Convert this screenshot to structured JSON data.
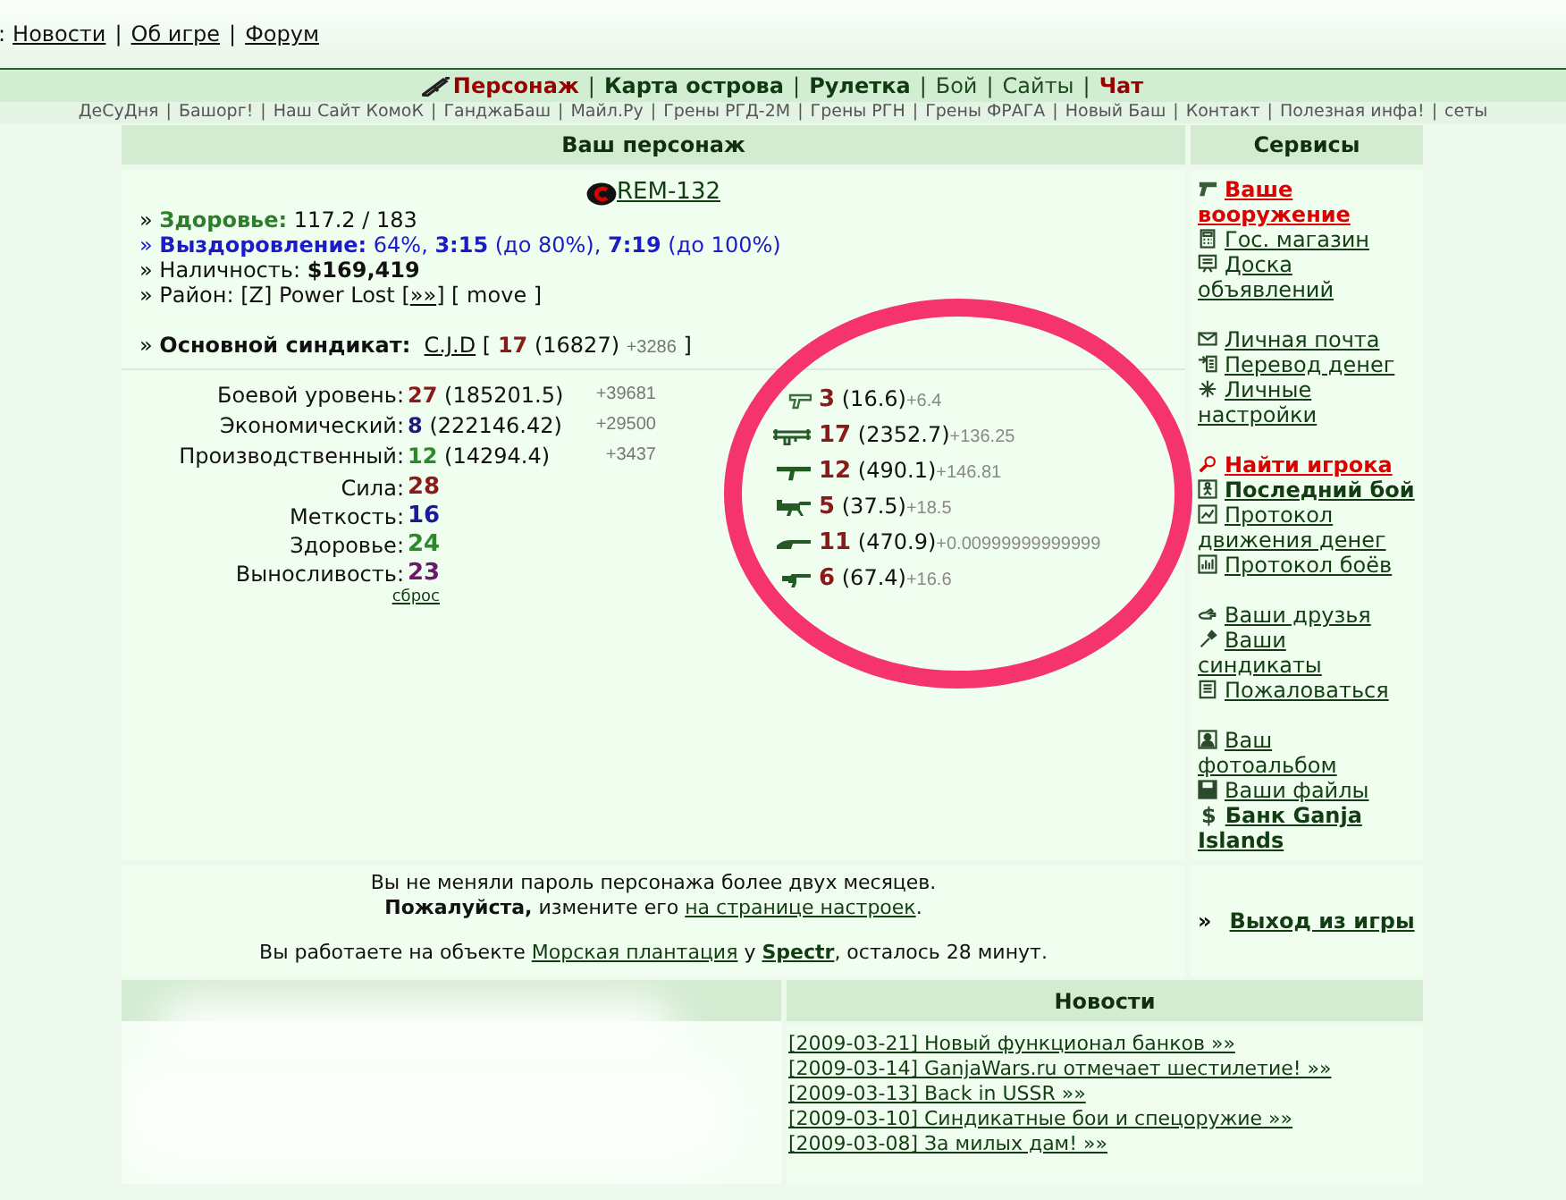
{
  "top_links": {
    "lead": ":",
    "separator": "|",
    "links": [
      "Новости",
      "Об игре",
      "Форум"
    ]
  },
  "nav": {
    "separator": "|",
    "items": [
      {
        "label": "Персонаж",
        "selected": true,
        "bold": true,
        "color": "#990000"
      },
      {
        "label": "Карта острова",
        "selected": false,
        "bold": true,
        "color": "#103a10"
      },
      {
        "label": "Рулетка",
        "selected": false,
        "bold": true,
        "color": "#103a10"
      },
      {
        "label": "Бой",
        "selected": false,
        "bold": false,
        "color": "#1f4a1f"
      },
      {
        "label": "Сайты",
        "selected": false,
        "bold": false,
        "color": "#1f4a1f"
      },
      {
        "label": "Чат",
        "selected": false,
        "bold": true,
        "color": "#990000"
      }
    ]
  },
  "sites": {
    "separator": "|",
    "links": [
      "ДеСуДня",
      "Башорг!",
      "Наш Сайт КомоК",
      "ГанджаБаш",
      "Майл.Ру",
      "Грены РГД-2М",
      "Грены РГН",
      "Грены ФРАГА",
      "Новый Баш",
      "Контакт",
      "Полезная инфа!",
      "сеты"
    ]
  },
  "character": {
    "title": "Ваш персонаж",
    "name": "REM-132",
    "health": {
      "bullet": "»",
      "label": "Здоровье:",
      "value": "117.2 / 183"
    },
    "recovery": {
      "bullet": "»",
      "text": "**Выздоровление:** 64%, **3:15** (до 80%), **7:19** (до 100%)"
    },
    "cash": {
      "bullet": "»",
      "label": "Наличность:",
      "value": "$169,419"
    },
    "district": {
      "bullet": "»",
      "text": "Район: [Z] Power Lost [",
      "link": "»»",
      "after": "] [ move ]"
    },
    "syndicate": {
      "bullet": "»",
      "label": "Основной синдикат:",
      "name": "C.J.D",
      "open": "[",
      "rank": "17",
      "points": "(16827)",
      "gain": "+3286",
      "close": "]"
    },
    "skills": [
      {
        "label": "Боевой уровень:",
        "rank": "27",
        "points": "(185201.5)",
        "gain": "+39681",
        "color": "#8b1a1a"
      },
      {
        "label": "Экономический:",
        "rank": "8",
        "points": "(222146.42)",
        "gain": "+29500",
        "color": "#1a1a80"
      },
      {
        "label": "Производственный:",
        "rank": "12",
        "points": "(14294.4)",
        "gain": "+3437",
        "color": "#2a8a2a"
      }
    ],
    "attributes": [
      {
        "label": "Сила:",
        "value": "28",
        "color": "#8b1a1a"
      },
      {
        "label": "Меткость:",
        "value": "16",
        "color": "#1a1a9a"
      },
      {
        "label": "Здоровье:",
        "value": "24",
        "color": "#2a8a2a"
      },
      {
        "label": "Выносливость:",
        "value": "23",
        "color": "#6b1a6b"
      }
    ],
    "reset": "сброс",
    "weapons": [
      {
        "rank": "3",
        "points": "(16.6)",
        "gain": "+6.4"
      },
      {
        "rank": "17",
        "points": "(2352.7)",
        "gain": "+136.25"
      },
      {
        "rank": "12",
        "points": "(490.1)",
        "gain": "+146.81"
      },
      {
        "rank": "5",
        "points": "(37.5)",
        "gain": "+18.5"
      },
      {
        "rank": "11",
        "points": "(470.9)",
        "gain": "+0.00999999999999"
      },
      {
        "rank": "6",
        "points": "(67.4)",
        "gain": "+16.6"
      }
    ]
  },
  "services": {
    "title": "Сервисы",
    "groups": [
      {
        "items": [
          {
            "label": "Ваше вооружение",
            "bold": true,
            "color": "#dd0000"
          },
          {
            "label": "Гос. магазин",
            "bold": false,
            "color": "#123d12"
          },
          {
            "label": "Доска объявлений",
            "bold": false,
            "color": "#123d12"
          }
        ]
      },
      {
        "items": [
          {
            "label": "Личная почта",
            "bold": false,
            "color": "#123d12"
          },
          {
            "label": "Перевод денег",
            "bold": false,
            "color": "#123d12"
          },
          {
            "label": "Личные настройки",
            "bold": false,
            "color": "#123d12"
          }
        ]
      },
      {
        "items": [
          {
            "label": "Найти игрока",
            "bold": true,
            "color": "#dd0000"
          },
          {
            "label": "Последний бой",
            "bold": true,
            "color": "#123d12"
          },
          {
            "label": "Протокол движения денег",
            "bold": false,
            "color": "#123d12"
          },
          {
            "label": "Протокол боёв",
            "bold": false,
            "color": "#123d12"
          }
        ]
      },
      {
        "items": [
          {
            "label": "Ваши друзья",
            "bold": false,
            "color": "#123d12"
          },
          {
            "label": "Ваши синдикаты",
            "bold": false,
            "color": "#123d12"
          },
          {
            "label": "Пожаловаться",
            "bold": false,
            "color": "#123d12"
          }
        ]
      },
      {
        "items": [
          {
            "label": "Ваш фотоальбом",
            "bold": false,
            "color": "#123d12"
          },
          {
            "label": "Ваши файлы",
            "bold": false,
            "color": "#123d12"
          },
          {
            "glyph": "$",
            "label": "Банк Ganja Islands",
            "bold": true,
            "color": "#123d12"
          }
        ]
      }
    ]
  },
  "notice": {
    "warning": "Вы не меняли пароль персонажа более двух месяцев.",
    "hint": {
      "before": "**Пожалуйста,** измените его ",
      "link": "на странице настроек",
      "after": "."
    },
    "work": {
      "before": "Вы работаете на объекте ",
      "place": "Морская плантация",
      "middle": " у ",
      "owner": "Spectr",
      "after": ", осталось 28 минут."
    }
  },
  "exit": {
    "bullet": "»",
    "label": "Выход из игры"
  },
  "news": {
    "title": "Новости",
    "items": [
      "[2009-03-21] Новый функционал банков »»",
      "[2009-03-14] GanjaWars.ru отмечает шестилетие! »»",
      "[2009-03-13] Back in USSR »»",
      "[2009-03-10] Синдикатные бои и спецоружие »»",
      "[2009-03-08] За милых дам! »»"
    ]
  }
}
